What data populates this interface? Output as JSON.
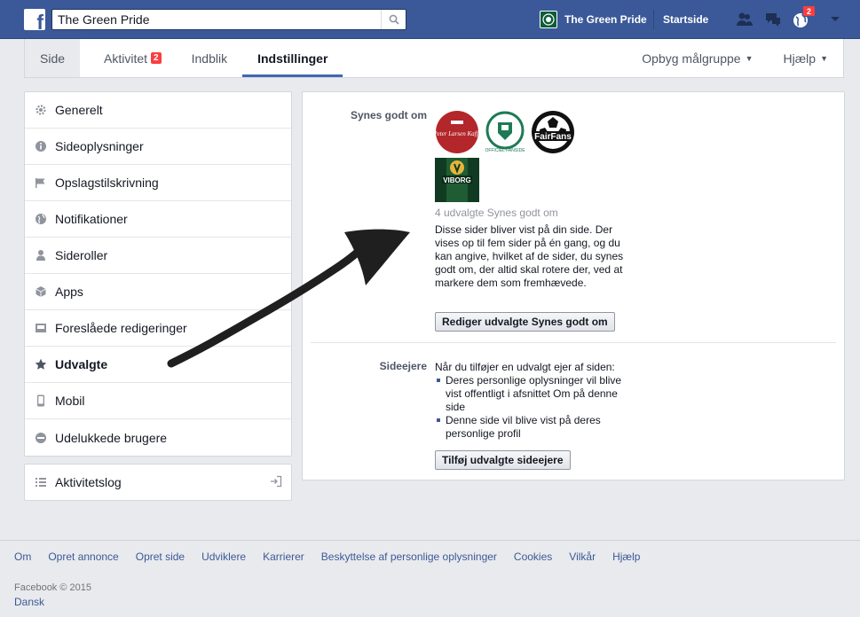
{
  "topbar": {
    "search_value": "The Green Pride",
    "page_name": "The Green Pride",
    "home_label": "Startside",
    "notifications_count": "2",
    "brand_color": "#3b5998"
  },
  "tabs": {
    "items": [
      {
        "label": "Side"
      },
      {
        "label": "Aktivitet",
        "badge": "2"
      },
      {
        "label": "Indblik"
      },
      {
        "label": "Indstillinger"
      }
    ],
    "right": [
      {
        "label": "Opbyg målgruppe"
      },
      {
        "label": "Hjælp"
      }
    ]
  },
  "menu": {
    "items": [
      {
        "label": "Generelt",
        "icon": "gear-icon"
      },
      {
        "label": "Sideoplysninger",
        "icon": "info-icon"
      },
      {
        "label": "Opslagstilskrivning",
        "icon": "flag-icon"
      },
      {
        "label": "Notifikationer",
        "icon": "globe-icon"
      },
      {
        "label": "Sideroller",
        "icon": "person-icon"
      },
      {
        "label": "Apps",
        "icon": "cube-icon"
      },
      {
        "label": "Foreslåede redigeringer",
        "icon": "inbox-icon"
      },
      {
        "label": "Udvalgte",
        "icon": "star-icon"
      },
      {
        "label": "Mobil",
        "icon": "phone-icon"
      },
      {
        "label": "Udelukkede brugere",
        "icon": "block-icon"
      }
    ],
    "activity_log": "Aktivitetslog"
  },
  "content": {
    "likes_label": "Synes godt om",
    "likes": [
      {
        "name": "Peter Larsen Kaffe",
        "text": "Peter Larsen Kaffe"
      },
      {
        "name": "Officiel Fanside",
        "text": "OFFICIEL FANSIDE"
      },
      {
        "name": "FairFans",
        "text": "FairFans"
      },
      {
        "name": "Viborg",
        "text": "VIBORG"
      }
    ],
    "likes_count": "4 udvalgte Synes godt om",
    "likes_desc": "Disse sider bliver vist på din side. Der vises op til fem sider på én gang, og du kan angive, hvilket af de sider, du synes godt om, der altid skal rotere der, ved at markere dem som fremhævede.",
    "likes_button": "Rediger udvalgte Synes godt om",
    "owners_label": "Sideejere",
    "owners_intro": "Når du tilføjer en udvalgt ejer af siden:",
    "owners_bullets": [
      "Deres personlige oplysninger vil blive vist offentligt i afsnittet Om på denne side",
      "Denne side vil blive vist på deres personlige profil"
    ],
    "owners_button": "Tilføj udvalgte sideejere"
  },
  "footer": {
    "links": [
      "Om",
      "Opret annonce",
      "Opret side",
      "Udviklere",
      "Karrierer",
      "Beskyttelse af personlige oplysninger",
      "Cookies",
      "Vilkår",
      "Hjælp"
    ],
    "copyright": "Facebook © 2015",
    "language": "Dansk"
  }
}
